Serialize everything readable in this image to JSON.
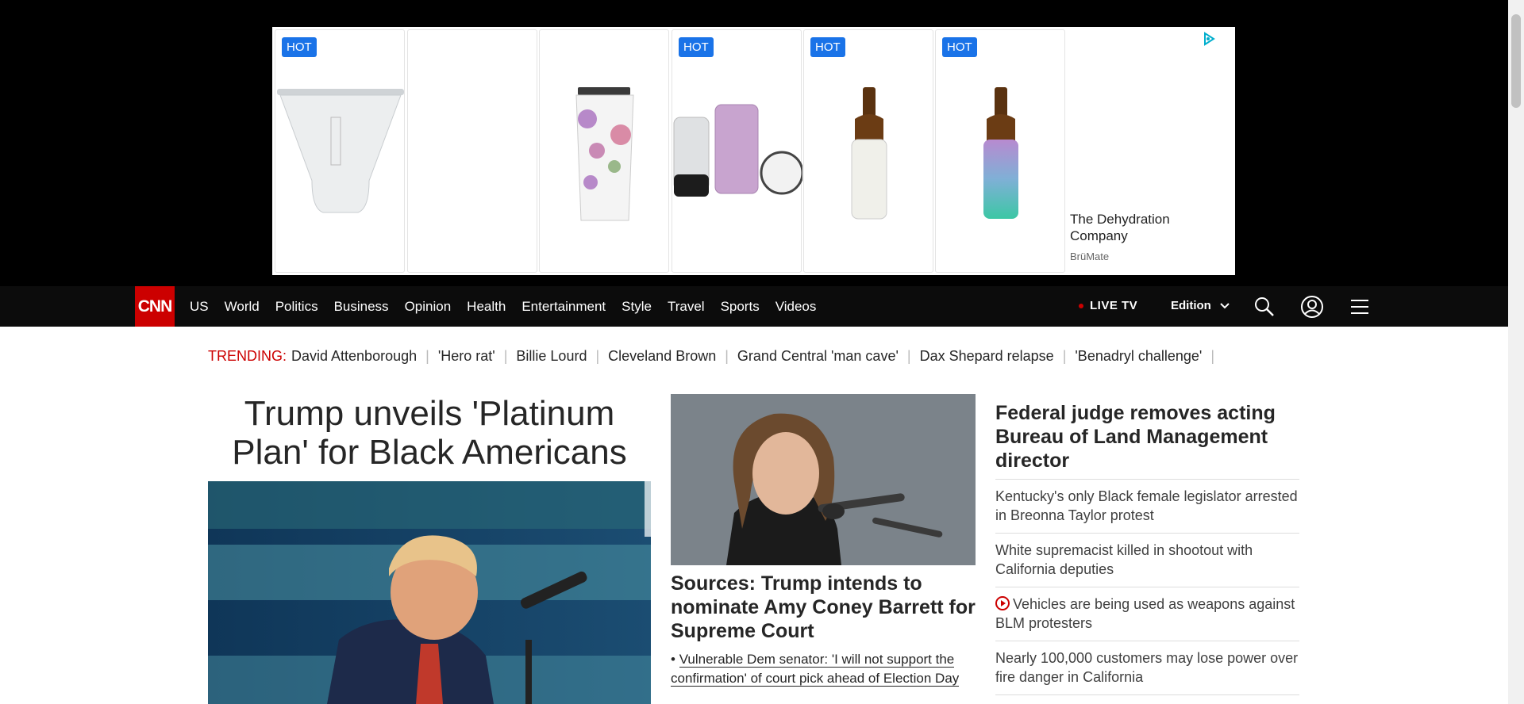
{
  "ad": {
    "hot_label": "HOT",
    "title": "The Dehydration Company",
    "brand": "BrüMate",
    "choices_icon": "ad-choices-icon"
  },
  "nav": {
    "logo": "CNN",
    "links": [
      "US",
      "World",
      "Politics",
      "Business",
      "Opinion",
      "Health",
      "Entertainment",
      "Style",
      "Travel",
      "Sports",
      "Videos"
    ],
    "live_tv": "LIVE TV",
    "edition": "Edition",
    "icons": [
      "search-icon",
      "account-icon",
      "menu-icon"
    ]
  },
  "trending": {
    "label": "TRENDING:",
    "items": [
      "David Attenborough",
      "'Hero rat'",
      "Billie Lourd",
      "Cleveland Brown",
      "Grand Central 'man cave'",
      "Dax Shepard relapse",
      "'Benadryl challenge'"
    ]
  },
  "lead": {
    "headline": "Trump unveils 'Platinum Plan' for Black Americans"
  },
  "middle": {
    "headline": "Sources: Trump intends to nominate Amy Coney Barrett for Supreme Court",
    "sub_prefix": "•",
    "sub": "Vulnerable Dem senator: 'I will not support the confirmation' of court pick ahead of Election Day"
  },
  "right": {
    "headline": "Federal judge removes acting Bureau of Land Management director",
    "items": [
      "Kentucky's only Black female legislator arrested in Breonna Taylor protest",
      "White supremacist killed in shootout with California deputies",
      "Vehicles are being used as weapons against BLM protesters",
      "Nearly 100,000 customers may lose power over fire danger in California"
    ]
  },
  "colors": {
    "brand_red": "#cc0000",
    "nav_bg": "#0c0c0c",
    "hot_blue": "#1a73e8"
  }
}
